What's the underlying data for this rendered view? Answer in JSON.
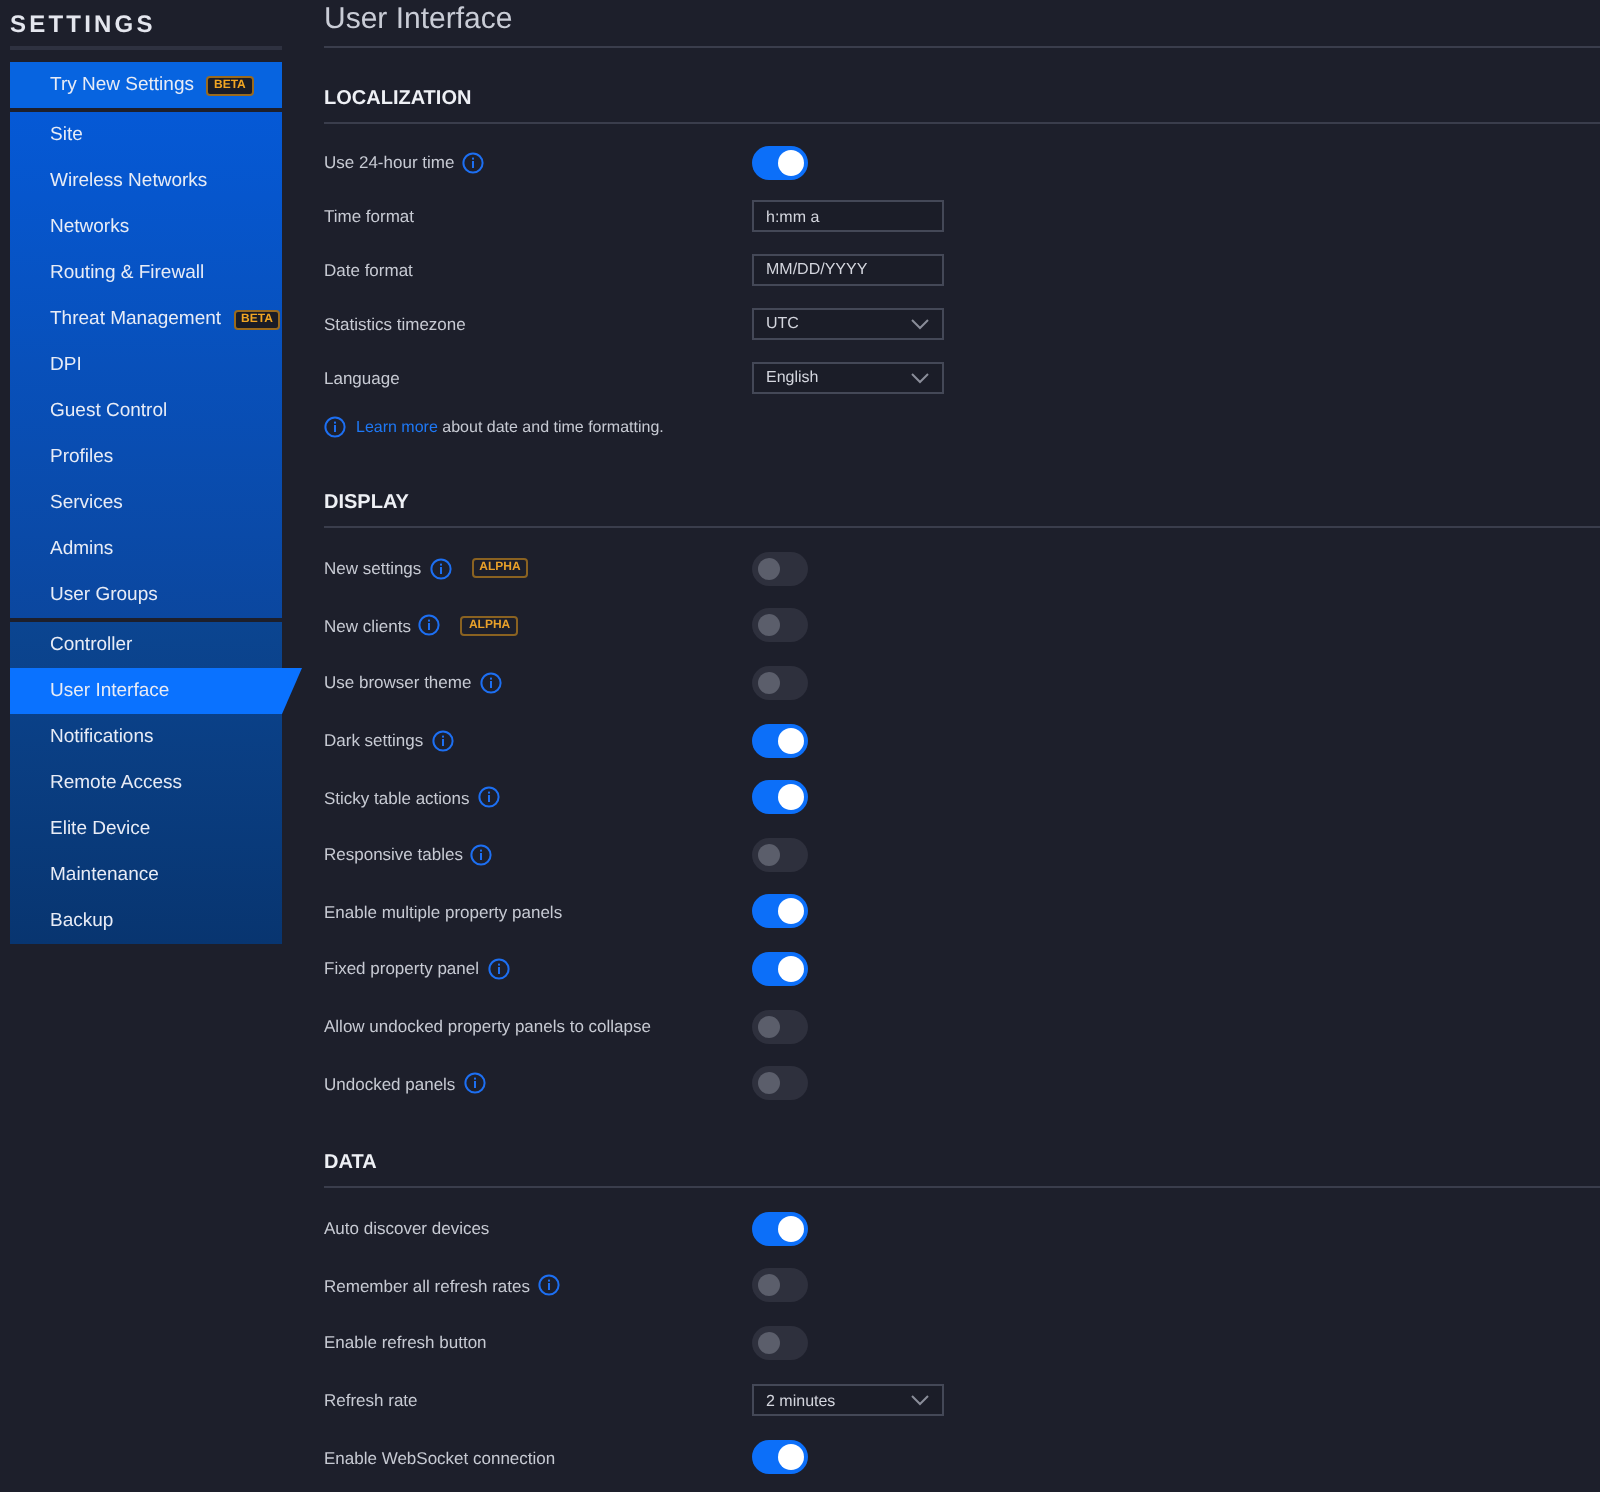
{
  "sidebar": {
    "title": "SETTINGS",
    "groups": [
      {
        "items": [
          {
            "label": "Try New Settings",
            "badge": "BETA",
            "selected": false
          }
        ]
      },
      {
        "items": [
          {
            "label": "Site",
            "selected": false
          },
          {
            "label": "Wireless Networks",
            "selected": false
          },
          {
            "label": "Networks",
            "selected": false
          },
          {
            "label": "Routing & Firewall",
            "selected": false
          },
          {
            "label": "Threat Management",
            "badge": "BETA",
            "selected": false
          },
          {
            "label": "DPI",
            "selected": false
          },
          {
            "label": "Guest Control",
            "selected": false
          },
          {
            "label": "Profiles",
            "selected": false
          },
          {
            "label": "Services",
            "selected": false
          },
          {
            "label": "Admins",
            "selected": false
          },
          {
            "label": "User Groups",
            "selected": false
          }
        ]
      },
      {
        "items": [
          {
            "label": "Controller",
            "selected": false
          },
          {
            "label": "User Interface",
            "selected": true
          },
          {
            "label": "Notifications",
            "selected": false
          },
          {
            "label": "Remote Access",
            "selected": false
          },
          {
            "label": "Elite Device",
            "selected": false
          },
          {
            "label": "Maintenance",
            "selected": false
          },
          {
            "label": "Backup",
            "selected": false
          }
        ]
      }
    ]
  },
  "page": {
    "title": "User Interface"
  },
  "sections": [
    {
      "heading": "LOCALIZATION",
      "rows": [
        {
          "kind": "toggle",
          "label": "Use 24-hour time",
          "info": true,
          "on": true
        },
        {
          "kind": "text",
          "label": "Time format",
          "info": false,
          "value": "h:mm a"
        },
        {
          "kind": "text",
          "label": "Date format",
          "info": false,
          "value": "MM/DD/YYYY"
        },
        {
          "kind": "select",
          "label": "Statistics timezone",
          "info": false,
          "value": "UTC"
        },
        {
          "kind": "select",
          "label": "Language",
          "info": false,
          "value": "English"
        }
      ],
      "note": {
        "link": "Learn more",
        "text": "about date and time formatting."
      }
    },
    {
      "heading": "DISPLAY",
      "rows": [
        {
          "kind": "toggle",
          "label": "New settings",
          "info": true,
          "badge": "ALPHA",
          "on": false
        },
        {
          "kind": "toggle",
          "label": "New clients",
          "info": true,
          "badge": "ALPHA",
          "on": false
        },
        {
          "kind": "toggle",
          "label": "Use browser theme",
          "info": true,
          "on": false
        },
        {
          "kind": "toggle",
          "label": "Dark settings",
          "info": true,
          "on": true
        },
        {
          "kind": "toggle",
          "label": "Sticky table actions",
          "info": true,
          "on": true
        },
        {
          "kind": "toggle",
          "label": "Responsive tables",
          "info": true,
          "on": false
        },
        {
          "kind": "toggle",
          "label": "Enable multiple property panels",
          "info": false,
          "on": true
        },
        {
          "kind": "toggle",
          "label": "Fixed property panel",
          "info": true,
          "on": true
        },
        {
          "kind": "toggle",
          "label": "Allow undocked property panels to collapse",
          "info": false,
          "on": false
        },
        {
          "kind": "toggle",
          "label": "Undocked panels",
          "info": true,
          "on": false
        }
      ]
    },
    {
      "heading": "DATA",
      "rows": [
        {
          "kind": "toggle",
          "label": "Auto discover devices",
          "info": false,
          "on": true
        },
        {
          "kind": "toggle",
          "label": "Remember all refresh rates",
          "info": true,
          "on": false
        },
        {
          "kind": "toggle",
          "label": "Enable refresh button",
          "info": false,
          "on": false
        },
        {
          "kind": "select",
          "label": "Refresh rate",
          "info": false,
          "value": "2 minutes"
        },
        {
          "kind": "toggle",
          "label": "Enable WebSocket connection",
          "info": false,
          "on": true
        }
      ]
    }
  ]
}
